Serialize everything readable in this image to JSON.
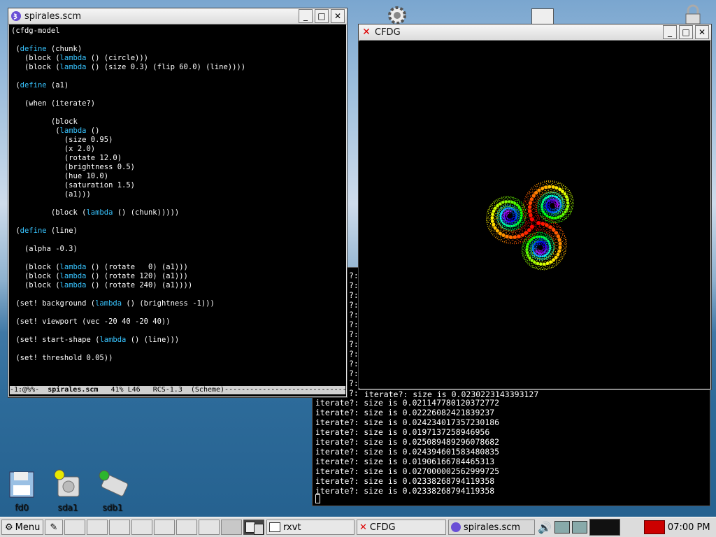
{
  "editor": {
    "title": "spirales.scm",
    "code_lines": [
      "(cfdg-model",
      "",
      " (define (chunk)",
      "   (block (lambda () (circle)))",
      "   (block (lambda () (size 0.3) (flip 60.0) (line))))",
      "",
      " (define (a1)",
      "",
      "   (when (iterate?)",
      "",
      "         (block",
      "          (lambda ()",
      "            (size 0.95)",
      "            (x 2.0)",
      "            (rotate 12.0)",
      "            (brightness 0.5)",
      "            (hue 10.0)",
      "            (saturation 1.5)",
      "            (a1)))",
      "",
      "         (block (lambda () (chunk)))))",
      "",
      " (define (line)",
      "",
      "   (alpha -0.3)",
      "",
      "   (block (lambda () (rotate   0) (a1)))",
      "   (block (lambda () (rotate 120) (a1)))",
      "   (block (lambda () (rotate 240) (a1))))",
      "",
      " (set! background (lambda () (brightness -1)))",
      "",
      " (set! viewport (vec -20 40 -20 40))",
      "",
      " (set! start-shape (lambda () (line)))",
      "",
      " (set! threshold 0.05))"
    ],
    "modeline_prefix": "-1:@%%-  ",
    "modeline_buffer": "spirales.scm",
    "modeline_rest": "   41% L46   RCS-1.3  (Scheme)------------------------------------------"
  },
  "cfdg": {
    "title": "CFDG"
  },
  "terminal": {
    "partial_top": "size is 0.0230223143393127",
    "side_fragments": [
      "?:",
      "?:",
      "?:",
      "?:",
      "?:",
      "?:",
      "?:",
      "?:",
      "?:",
      "?:",
      "?:",
      "?:",
      "?:"
    ],
    "lines": [
      "iterate?: size is 0.021147780120372772",
      "iterate?: size is 0.02226082421839237",
      "iterate?: size is 0.024234017357230186",
      "iterate?: size is 0.0197137258946956",
      "iterate?: size is 0.025089489296078682",
      "iterate?: size is 0.024394601583480835",
      "iterate?: size is 0.01906166784465313",
      "iterate?: size is 0.027000002562999725",
      "iterate?: size is 0.02338268794119358",
      "iterate?: size is 0.02338268794119358"
    ]
  },
  "desktop_icons": [
    {
      "label": "fd0",
      "icon": "floppy-disk-icon"
    },
    {
      "label": "sda1",
      "icon": "hard-drive-icon"
    },
    {
      "label": "sdb1",
      "icon": "usb-drive-icon"
    }
  ],
  "taskbar": {
    "menu_label": "Menu",
    "tasks": [
      {
        "label": "rxvt",
        "icon": "terminal-icon"
      },
      {
        "label": "CFDG",
        "icon": "x-icon"
      },
      {
        "label": "spirales.scm",
        "icon": "emacs-icon"
      }
    ],
    "clock": "07:00 PM"
  },
  "colors": {
    "keyword": "#38c4ff",
    "spiral_start": "#ff0000",
    "spiral_end": "#b000ff"
  }
}
